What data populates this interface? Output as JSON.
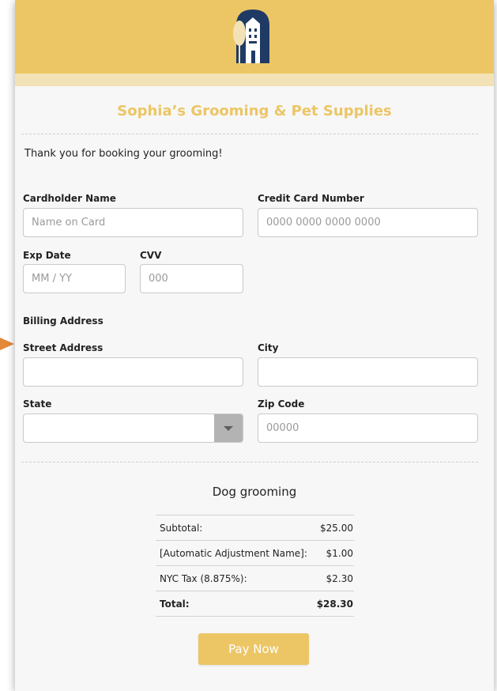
{
  "store": {
    "name": "Sophia’s Grooming & Pet Supplies"
  },
  "message": {
    "thanks": "Thank you for booking your grooming!"
  },
  "form": {
    "cardholder_label": "Cardholder Name",
    "cardholder_placeholder": "Name on Card",
    "cardnumber_label": "Credit Card Number",
    "cardnumber_placeholder": "0000 0000 0000 0000",
    "exp_label": "Exp Date",
    "exp_placeholder": "MM / YY",
    "cvv_label": "CVV",
    "cvv_placeholder": "000",
    "billing_heading": "Billing Address",
    "street_label": "Street Address",
    "city_label": "City",
    "state_label": "State",
    "state_value": "",
    "zip_label": "Zip Code",
    "zip_placeholder": "00000"
  },
  "summary": {
    "product": "Dog grooming",
    "rows": [
      {
        "label": "Subtotal:",
        "value": "$25.00"
      },
      {
        "label": "[Automatic Adjustment Name]:",
        "value": "$1.00"
      },
      {
        "label": "NYC Tax (8.875%):",
        "value": "$2.30"
      },
      {
        "label": "Total:",
        "value": "$28.30"
      }
    ]
  },
  "actions": {
    "pay_label": "Pay Now"
  },
  "colors": {
    "accent": "#ecc665",
    "logo": "#1f3a64"
  }
}
